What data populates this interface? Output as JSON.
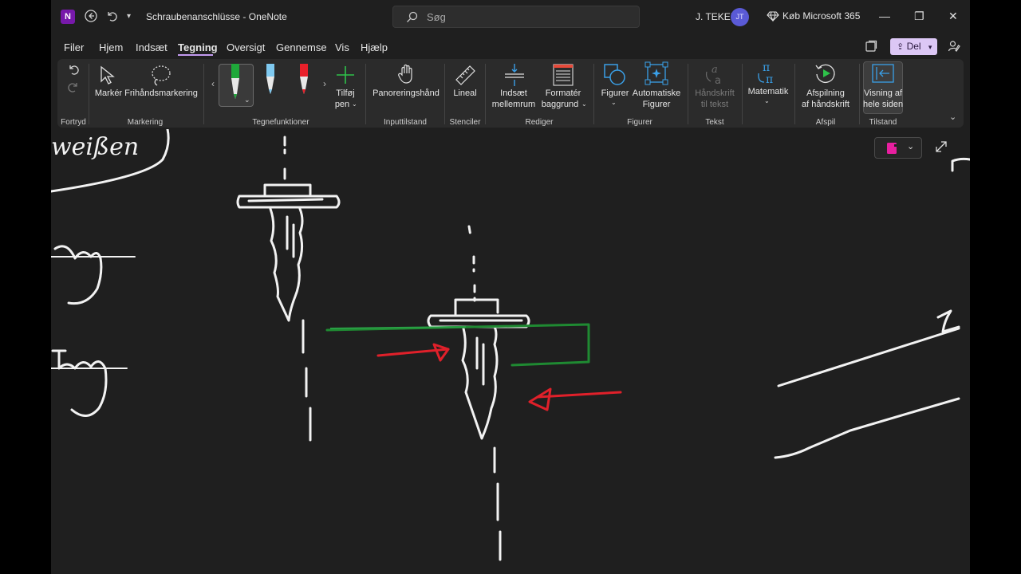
{
  "titlebar": {
    "app_letter": "N",
    "document_title": "Schraubenanschlüsse - OneNote",
    "search_placeholder": "Søg",
    "user_name": "J. TEKEL",
    "user_initials": "JT",
    "buy_label": "Køb Microsoft 365",
    "minimize_glyph": "—",
    "restore_glyph": "❐",
    "close_glyph": "✕"
  },
  "menu": {
    "items": [
      "Filer",
      "Hjem",
      "Indsæt",
      "Tegning",
      "Oversigt",
      "Gennemse",
      "Vis",
      "Hjælp"
    ],
    "active": "Tegning",
    "share_label": "Del"
  },
  "ribbon": {
    "groups": {
      "undo": "Fortryd",
      "select": "Markering",
      "pens": "Tegnefunktioner",
      "input": "Inputtilstand",
      "stencils": "Stenciler",
      "edit": "Rediger",
      "shapes": "Figurer",
      "text": "Tekst",
      "math": "",
      "replay": "Afspil",
      "mode": "Tilstand"
    },
    "buttons": {
      "select": "Markér",
      "lasso": "Frihåndsmarkering",
      "add_pen_1": "Tilføj",
      "add_pen_2": "pen",
      "panning": "Panoreringshånd",
      "ruler": "Lineal",
      "insert_space_1": "Indsæt",
      "insert_space_2": "mellemrum",
      "format_bg_1": "Formatér",
      "format_bg_2": "baggrund",
      "shapes": "Figurer",
      "auto_shapes_1": "Automatiske",
      "auto_shapes_2": "Figurer",
      "ink_to_text_1": "Håndskrift",
      "ink_to_text_2": "til tekst",
      "math": "Matematik",
      "ink_replay_1": "Afspilning",
      "ink_replay_2": "af håndskrift",
      "full_page_1": "Visning af",
      "full_page_2": "hele siden"
    },
    "pens": [
      {
        "color": "#1fa83a",
        "selected": true
      },
      {
        "color": "#7fc9f0",
        "selected": false
      },
      {
        "color": "#e8202a",
        "selected": false
      }
    ],
    "accent": "#c39af0"
  },
  "canvas": {
    "handwriting_top_left": "weißen",
    "notebook_color": "#e81fa0"
  }
}
